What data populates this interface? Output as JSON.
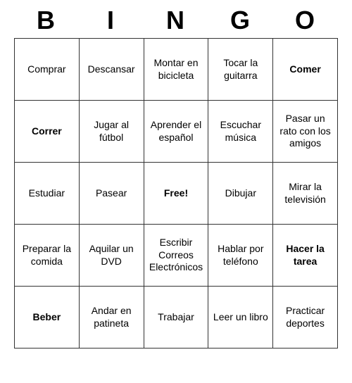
{
  "title": {
    "letters": [
      "B",
      "I",
      "N",
      "G",
      "O"
    ]
  },
  "grid": [
    [
      {
        "text": "Comprar",
        "size": "normal"
      },
      {
        "text": "Descansar",
        "size": "normal"
      },
      {
        "text": "Montar en bicicleta",
        "size": "normal"
      },
      {
        "text": "Tocar la guitarra",
        "size": "normal"
      },
      {
        "text": "Comer",
        "size": "large"
      }
    ],
    [
      {
        "text": "Correr",
        "size": "large"
      },
      {
        "text": "Jugar al fútbol",
        "size": "normal"
      },
      {
        "text": "Aprender el español",
        "size": "normal"
      },
      {
        "text": "Escuchar música",
        "size": "normal"
      },
      {
        "text": "Pasar un rato con los amigos",
        "size": "small"
      }
    ],
    [
      {
        "text": "Estudiar",
        "size": "normal"
      },
      {
        "text": "Pasear",
        "size": "normal"
      },
      {
        "text": "Free!",
        "size": "free"
      },
      {
        "text": "Dibujar",
        "size": "normal"
      },
      {
        "text": "Mirar la televisión",
        "size": "normal"
      }
    ],
    [
      {
        "text": "Preparar la comida",
        "size": "normal"
      },
      {
        "text": "Aquilar un DVD",
        "size": "normal"
      },
      {
        "text": "Escribir Correos Electrónicos",
        "size": "small"
      },
      {
        "text": "Hablar por teléfono",
        "size": "normal"
      },
      {
        "text": "Hacer la tarea",
        "size": "large"
      }
    ],
    [
      {
        "text": "Beber",
        "size": "large"
      },
      {
        "text": "Andar en patineta",
        "size": "normal"
      },
      {
        "text": "Trabajar",
        "size": "normal"
      },
      {
        "text": "Leer un libro",
        "size": "normal"
      },
      {
        "text": "Practicar deportes",
        "size": "normal"
      }
    ]
  ]
}
